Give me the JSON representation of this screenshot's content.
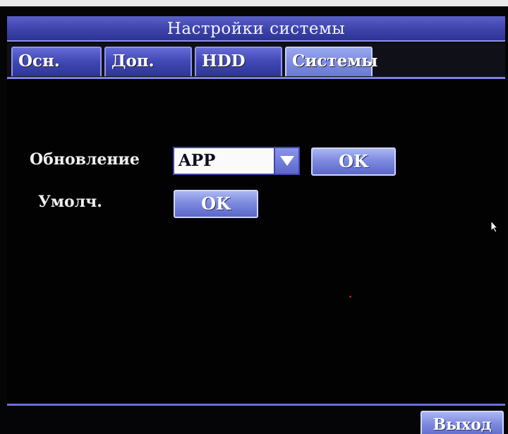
{
  "window": {
    "title": "Настройки системы"
  },
  "tabs": [
    {
      "label": "Осн."
    },
    {
      "label": "Доп."
    },
    {
      "label": "HDD"
    },
    {
      "label": "Системы",
      "active": true
    }
  ],
  "settings": {
    "update_label": "Обновление",
    "update_value": "APP",
    "update_ok_label": "OK",
    "default_label": "Умолч.",
    "default_ok_label": "OK"
  },
  "footer": {
    "exit_label": "Выход"
  },
  "colors": {
    "accent": "#4047b4",
    "active_tab": "#7c8ce0",
    "background": "#050505"
  },
  "icons": {
    "dropdown": "triangle-down-icon",
    "cursor": "mouse-pointer-icon"
  }
}
